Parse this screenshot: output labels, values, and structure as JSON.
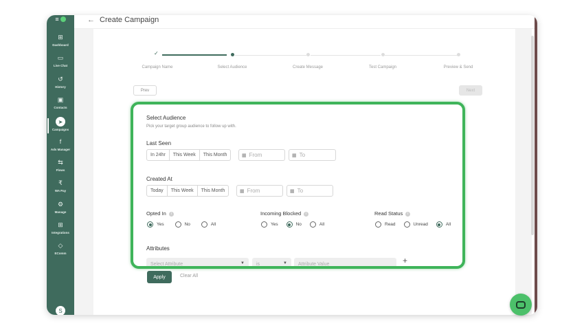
{
  "sidebar": {
    "items": [
      {
        "label": "Dashboard",
        "icon": "dashboard-icon",
        "glyph": "⊞"
      },
      {
        "label": "Live Chat",
        "icon": "chat-icon",
        "glyph": "▭"
      },
      {
        "label": "History",
        "icon": "history-icon",
        "glyph": "↺"
      },
      {
        "label": "Contacts",
        "icon": "contacts-icon",
        "glyph": "▣"
      },
      {
        "label": "Campaigns",
        "icon": "campaign-icon",
        "glyph": "➤"
      },
      {
        "label": "Ads Manager",
        "icon": "facebook-icon",
        "glyph": "f"
      },
      {
        "label": "Flows",
        "icon": "flows-icon",
        "glyph": "⇆"
      },
      {
        "label": "WA Pay",
        "icon": "pay-icon",
        "glyph": "₹"
      },
      {
        "label": "Manage",
        "icon": "gear-icon",
        "glyph": "⚙"
      },
      {
        "label": "Integrations",
        "icon": "integrations-icon",
        "glyph": "⊞"
      },
      {
        "label": "EComm",
        "icon": "tag-icon",
        "glyph": "◇"
      }
    ],
    "avatar": "S"
  },
  "header": {
    "back_glyph": "←",
    "title": "Create Campaign"
  },
  "stepper": {
    "steps": [
      "Campaign Name",
      "Select Audience",
      "Create Message",
      "Test Campaign",
      "Preview & Send"
    ],
    "completed_glyph": "✓"
  },
  "nav_buttons": {
    "prev": "Prev",
    "next": "Next"
  },
  "audience": {
    "title": "Select Audience",
    "subtitle": "Pick your target group audience to follow up with.",
    "last_seen": {
      "label": "Last Seen",
      "options": [
        "In 24hr",
        "This Week",
        "This Month"
      ],
      "from_placeholder": "From",
      "to_placeholder": "To"
    },
    "created_at": {
      "label": "Created At",
      "options": [
        "Today",
        "This Week",
        "This Month"
      ],
      "from_placeholder": "From",
      "to_placeholder": "To"
    },
    "opted_in": {
      "label": "Opted In",
      "options": [
        "Yes",
        "No",
        "All"
      ],
      "selected": "Yes"
    },
    "incoming_blocked": {
      "label": "Incoming Blocked",
      "options": [
        "Yes",
        "No",
        "All"
      ],
      "selected": "No"
    },
    "read_status": {
      "label": "Read Status",
      "options": [
        "Read",
        "Unread",
        "All"
      ],
      "selected": "All"
    },
    "attributes": {
      "label": "Attributes",
      "select_placeholder": "Select Attribute",
      "operator": "is",
      "value_placeholder": "Attribute Value",
      "add_glyph": "+"
    }
  },
  "actions": {
    "apply": "Apply",
    "clear": "Clear All"
  },
  "colors": {
    "brand": "#3f6b5d",
    "highlight": "#3fb45a",
    "chat": "#4cc06a"
  }
}
